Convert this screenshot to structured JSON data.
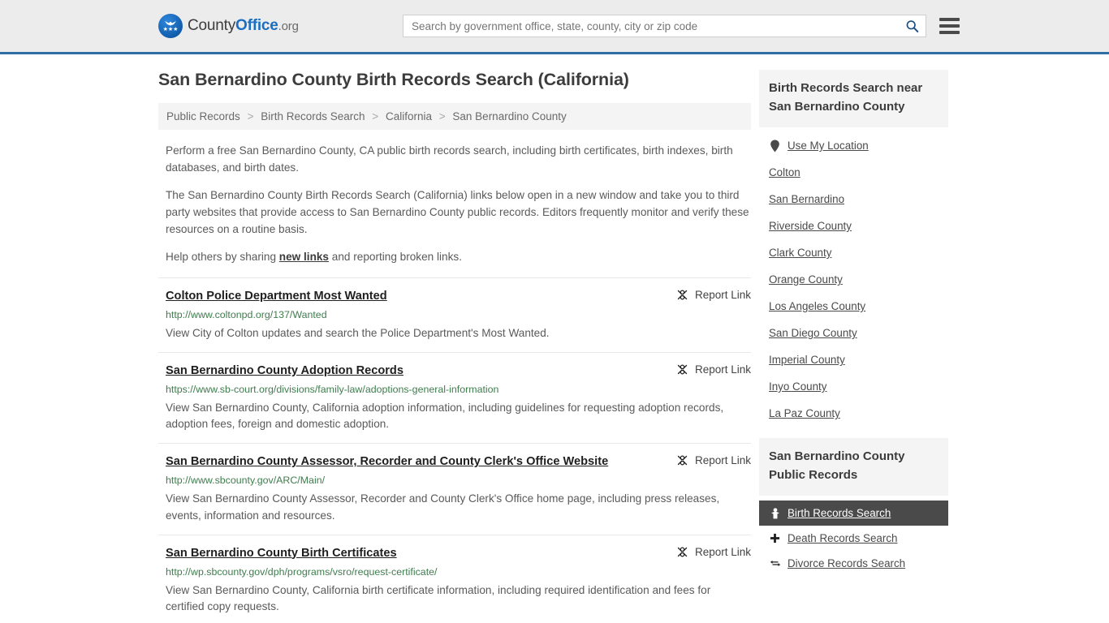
{
  "header": {
    "logo": {
      "part1": "County",
      "part2": "Office",
      "part3": ".org",
      "stars": "★★★"
    },
    "search": {
      "placeholder": "Search by government office, state, county, city or zip code",
      "value": "",
      "search_icon": "search-icon",
      "menu_icon": "hamburger-menu-icon"
    }
  },
  "main": {
    "title": "San Bernardino County Birth Records Search (California)",
    "breadcrumb": [
      "Public Records",
      "Birth Records Search",
      "California",
      "San Bernardino County"
    ],
    "breadcrumb_separator": ">",
    "intro": {
      "p1": "Perform a free San Bernardino County, CA public birth records search, including birth certificates, birth indexes, birth databases, and birth dates.",
      "p2": "The San Bernardino County Birth Records Search (California) links below open in a new window and take you to third party websites that provide access to San Bernardino County public records. Editors frequently monitor and verify these resources on a routine basis.",
      "p3_before": "Help others by sharing ",
      "p3_link": "new links",
      "p3_after": " and reporting broken links."
    },
    "report_link_label": "Report Link",
    "results": [
      {
        "title": "Colton Police Department Most Wanted",
        "url": "http://www.coltonpd.org/137/Wanted",
        "description": "View City of Colton updates and search the Police Department's Most Wanted."
      },
      {
        "title": "San Bernardino County Adoption Records",
        "url": "https://www.sb-court.org/divisions/family-law/adoptions-general-information",
        "description": "View San Bernardino County, California adoption information, including guidelines for requesting adoption records, adoption fees, foreign and domestic adoption."
      },
      {
        "title": "San Bernardino County Assessor, Recorder and County Clerk's Office Website",
        "url": "http://www.sbcounty.gov/ARC/Main/",
        "description": "View San Bernardino County Assessor, Recorder and County Clerk's Office home page, including press releases, events, information and resources."
      },
      {
        "title": "San Bernardino County Birth Certificates",
        "url": "http://wp.sbcounty.gov/dph/programs/vsro/request-certificate/",
        "description": "View San Bernardino County, California birth certificate information, including required identification and fees for certified copy requests."
      }
    ]
  },
  "sidebar": {
    "nearby": {
      "heading": "Birth Records Search near San Bernardino County",
      "items": [
        {
          "label": "Use My Location",
          "icon": "location-pin-icon"
        },
        {
          "label": "Colton",
          "icon": ""
        },
        {
          "label": "San Bernardino",
          "icon": ""
        },
        {
          "label": "Riverside County",
          "icon": ""
        },
        {
          "label": "Clark County",
          "icon": ""
        },
        {
          "label": "Orange County",
          "icon": ""
        },
        {
          "label": "Los Angeles County",
          "icon": ""
        },
        {
          "label": "San Diego County",
          "icon": ""
        },
        {
          "label": "Imperial County",
          "icon": ""
        },
        {
          "label": "Inyo County",
          "icon": ""
        },
        {
          "label": "La Paz County",
          "icon": ""
        }
      ]
    },
    "public_records": {
      "heading": "San Bernardino County Public Records",
      "items": [
        {
          "label": "Birth Records Search",
          "icon": "baby-icon",
          "active": true
        },
        {
          "label": "Death Records Search",
          "icon": "cross-icon",
          "active": false
        },
        {
          "label": "Divorce Records Search",
          "icon": "split-arrows-icon",
          "active": false
        }
      ]
    }
  },
  "colors": {
    "header_bg": "#ececec",
    "header_border": "#2f6ea5",
    "brand_blue": "#1b6ec2",
    "url_green": "#3f7d4e",
    "panel_bg": "#f4f4f4",
    "active_bg": "#4a4a4a"
  }
}
